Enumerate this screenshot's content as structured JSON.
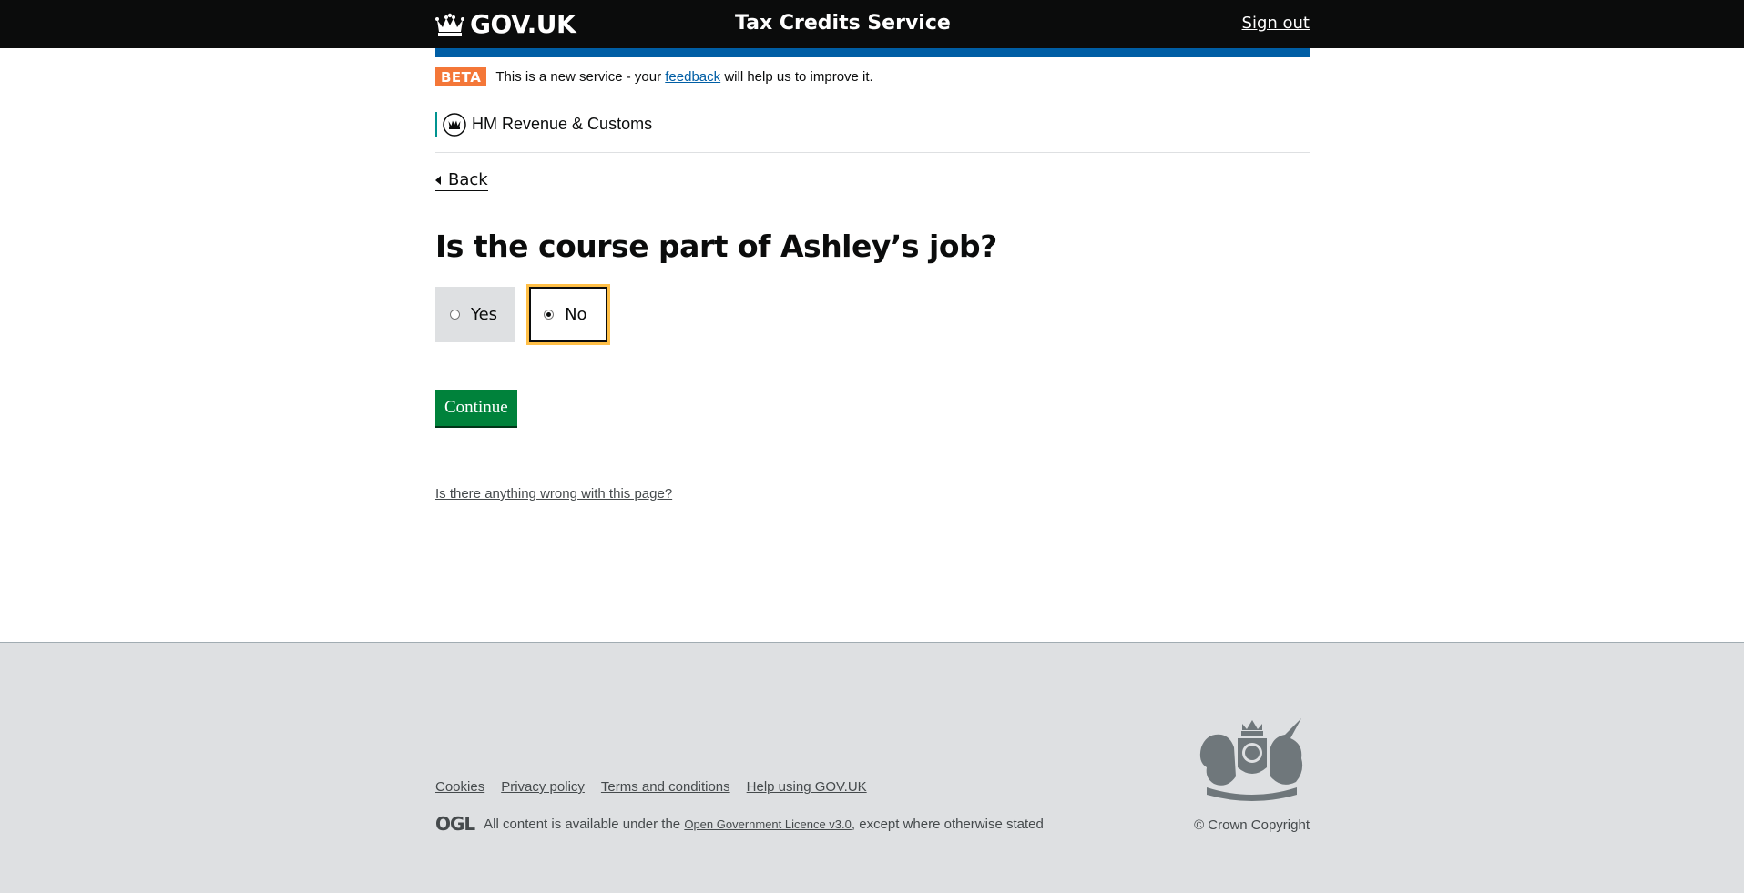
{
  "header": {
    "logo_text": "GOV.UK",
    "service_name": "Tax Credits Service",
    "sign_out_label": "Sign out"
  },
  "phase_banner": {
    "tag": "BETA",
    "text_before": "This is a new service - your",
    "feedback_link": "feedback",
    "text_after": "will help us to improve it."
  },
  "department": {
    "name": "HM Revenue & Customs"
  },
  "back_link": "Back",
  "question": "Is the course part of Ashley’s job?",
  "radios": {
    "options": [
      {
        "label": "Yes",
        "checked": false
      },
      {
        "label": "No",
        "checked": true
      }
    ]
  },
  "continue_label": "Continue",
  "report_link": "Is there anything wrong with this page?",
  "footer": {
    "links": [
      "Cookies",
      "Privacy policy",
      "Terms and conditions",
      "Help using GOV.UK"
    ],
    "ogl_logo": "OGL",
    "licence_before": "All content is available under the",
    "licence_link": "Open Government Licence v3.0",
    "licence_after": ", except where otherwise stated",
    "copyright": "© Crown Copyright"
  },
  "colors": {
    "header_bg": "#0b0c0c",
    "blue_bar": "#005ea5",
    "beta_tag": "#f47738",
    "continue_button": "#00823b",
    "focus_outline": "#ffbf47",
    "footer_bg": "#dee0e2"
  }
}
